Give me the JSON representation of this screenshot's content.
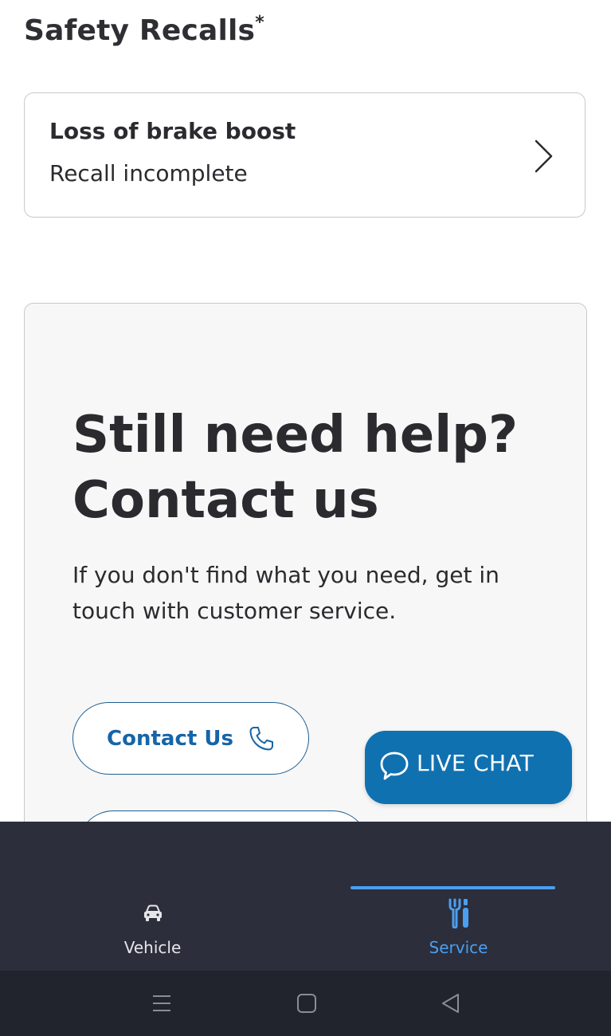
{
  "section": {
    "title": "Safety Recalls",
    "title_mark": "*"
  },
  "recall": {
    "title": "Loss of brake boost",
    "status": "Recall incomplete"
  },
  "help": {
    "heading_line1": "Still need help?",
    "heading_line2": "Contact us",
    "text": "If you don't find what you need, get in touch with customer service.",
    "contact_label": "Contact Us"
  },
  "live_chat": {
    "label": "LIVE CHAT"
  },
  "tabs": [
    {
      "label": "Vehicle",
      "icon": "car-icon",
      "active": false
    },
    {
      "label": "Service",
      "icon": "tools-icon",
      "active": true
    }
  ],
  "system_nav": {
    "icons": [
      "menu-icon",
      "home-icon",
      "back-icon"
    ]
  },
  "colors": {
    "accent": "#1565a8",
    "live_chat_bg": "#1071b0",
    "tab_bar_bg": "#2c2e3b",
    "tab_active": "#4a9ff0"
  }
}
